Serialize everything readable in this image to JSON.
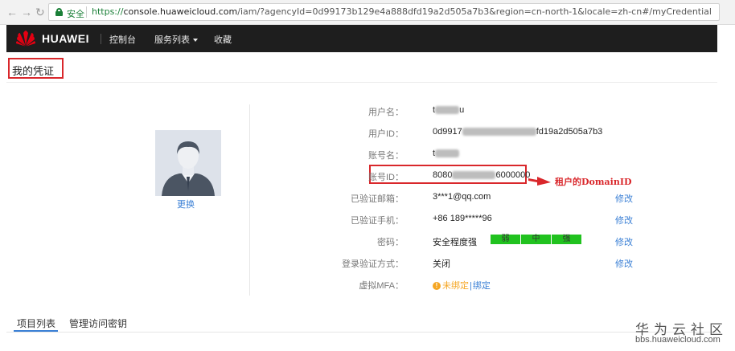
{
  "browser": {
    "secure_label": "安全",
    "url_scheme": "https://",
    "url_host": "console.huaweicloud.com",
    "url_path": "/iam/?agencyId=0d99173b129e4a888dfd19a2d505a7b3&region=cn-north-1&locale=zh-cn#/myCredential"
  },
  "header": {
    "brand": "HUAWEI",
    "nav": [
      {
        "label": "控制台"
      },
      {
        "label": "服务列表"
      },
      {
        "label": "收藏"
      }
    ]
  },
  "page": {
    "title": "我的凭证"
  },
  "avatar": {
    "change_label": "更换"
  },
  "info": {
    "username_label": "用户名：",
    "username_prefix": "t",
    "username_suffix": "u",
    "userid_label": "用户ID：",
    "userid_prefix": "0d9917",
    "userid_suffix": "fd19a2d505a7b3",
    "account_label": "账号名：",
    "account_prefix": "t",
    "accountid_label": "账号ID：",
    "accountid_prefix": "8080",
    "accountid_suffix": "6000000",
    "email_label": "已验证邮箱：",
    "email_value": "3***1@qq.com",
    "phone_label": "已验证手机：",
    "phone_value": "+86 189*****96",
    "password_label": "密码：",
    "password_value": "安全程度强",
    "strength_levels": [
      "弱",
      "中",
      "强"
    ],
    "login_verify_label": "登录验证方式：",
    "login_verify_value": "关闭",
    "mfa_label": "虚拟MFA：",
    "mfa_status": "未绑定",
    "mfa_separator": "|",
    "mfa_bind": "绑定",
    "edit_label": "修改"
  },
  "annotation": {
    "text": "租户的DomainID"
  },
  "tabs": [
    {
      "label": "项目列表",
      "active": true
    },
    {
      "label": "管理访问密钥",
      "active": false
    }
  ],
  "watermark": {
    "main": "华为云社区",
    "sub": "bbs.huaweicloud.com"
  },
  "colors": {
    "accent": "#3a7fd5",
    "highlight": "#d9272b",
    "strength": "#21c21f",
    "warning": "#f5a623",
    "header_bg": "#1e1e1e"
  }
}
